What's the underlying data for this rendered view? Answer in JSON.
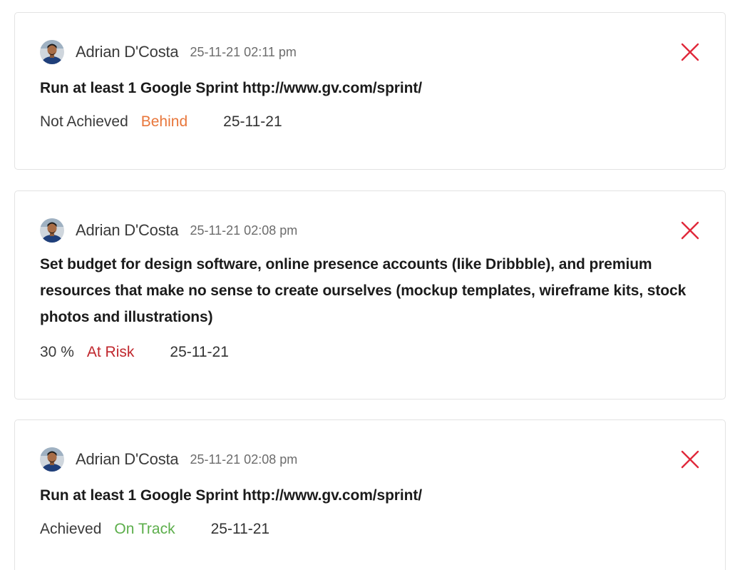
{
  "colors": {
    "behind": "#e8763a",
    "at_risk": "#c0272d",
    "on_track": "#5cae4b",
    "close_icon": "#e0283a"
  },
  "feed": [
    {
      "author": "Adrian D'Costa",
      "timestamp": "25-11-21 02:11 pm",
      "title": "Run at least 1 Google Sprint http://www.gv.com/sprint/",
      "progress": "Not Achieved",
      "status": "Behind",
      "date": "25-11-21",
      "avatar_icon": "user-avatar",
      "close_icon": "close-icon"
    },
    {
      "author": "Adrian D'Costa",
      "timestamp": "25-11-21 02:08 pm",
      "title": "Set budget for design software, online presence accounts (like Dribbble), and premium resources that make no sense to create ourselves (mockup templates, wireframe kits, stock photos and illustrations)",
      "progress": "30 %",
      "status": "At Risk",
      "date": "25-11-21",
      "avatar_icon": "user-avatar",
      "close_icon": "close-icon"
    },
    {
      "author": "Adrian D'Costa",
      "timestamp": "25-11-21 02:08 pm",
      "title": "Run at least 1 Google Sprint http://www.gv.com/sprint/",
      "progress": "Achieved",
      "status": "On Track",
      "date": "25-11-21",
      "avatar_icon": "user-avatar",
      "close_icon": "close-icon"
    }
  ]
}
